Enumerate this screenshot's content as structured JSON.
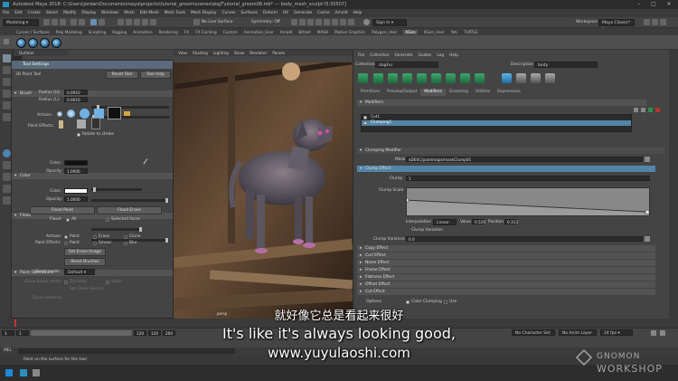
{
  "window": {
    "title": "Autodesk Maya 2018: C:\\Users\\jordan\\Documents\\maya\\projects\\tutorial_groom\\scenes\\dogT\\utorial_groom08.mb* --- body_mesh_sculpt:f3:30507]"
  },
  "menu": [
    "File",
    "Edit",
    "Create",
    "Select",
    "Modify",
    "Display",
    "Windows",
    "Mesh",
    "Edit Mesh",
    "Mesh Tools",
    "Mesh Display",
    "Curves",
    "Surfaces",
    "Deform",
    "UV",
    "Generate",
    "Cache",
    "Arnold",
    "Help"
  ],
  "statusline": {
    "mode": "Modeling",
    "no_live_surface": "No Live Surface",
    "symmetry": "Symmetry: Off",
    "sign_in": "Sign In",
    "workspace_label": "Workspace :",
    "workspace": "Maya Classic*"
  },
  "shelf_tabs": [
    "Curves / Surfaces",
    "Poly Modeling",
    "Sculpting",
    "Rigging",
    "Animation",
    "Rendering",
    "FX",
    "FX Caching",
    "Custom",
    "Animation_User",
    "Arnold",
    "Bifrost",
    "MASH",
    "Motion Graphics",
    "Polygon_User",
    "XGen",
    "XGen_User",
    "Yeti",
    "TURTLE"
  ],
  "shelf_active_tab": "XGen",
  "viewport": {
    "menu": [
      "View",
      "Shading",
      "Lighting",
      "Show",
      "Renderer",
      "Panels"
    ],
    "camera_label": "persp"
  },
  "outliner_label": "Outliner",
  "tool_settings": {
    "title": "Tool Settings",
    "tool_name": "3D Paint Tool",
    "reset_button": "Reset Tool",
    "help_button": "Tool Help",
    "brush_header": "Brush",
    "radius_u_label": "Radius (U):",
    "radius_u_value": "0.0910",
    "radius_l_label": "Radius (L):",
    "radius_l_value": "0.0010",
    "artisan_label": "Artisan:",
    "paint_effects_label": "Paint Effects:",
    "rotate_label": "Rotate to stroke",
    "color_header": "Color",
    "color_label": "Color:",
    "opacity_label": "Opacity:",
    "opacity_value": "1.0000",
    "flood_header": "Flood",
    "flood_color_label": "Color:",
    "flood_opacity_label": "Opacity:",
    "flood_opacity_value": "1.0000",
    "flood_paint_button": "Flood Paint",
    "flood_erase_button": "Flood Erase",
    "flood_label": "Flood:",
    "flood_all": "All",
    "flood_selected": "Selected faces",
    "paint_ops_header": "Paint Operations",
    "artisan_ops_label": "Artisan:",
    "op_paint": "Paint",
    "op_erase": "Erase",
    "op_clone": "Clone",
    "pe_ops_label": "Paint Effects:",
    "op_paint2": "Paint",
    "op_smear": "Smear",
    "op_blur": "Blur",
    "set_erase_button": "Set Erase Image",
    "reset_brushes_button": "Reset Brushes",
    "blend_mode_label": "Blend mode:",
    "blend_mode_value": "Default",
    "clone_brush_label": "Clone brush mode:",
    "clone_dynamic": "Dynamic",
    "clone_static": "Static",
    "set_clone_source": "Set Clone Source",
    "clone_intensity_label": "Clone intensity:",
    "file_textures_header": "File Textures"
  },
  "xgen": {
    "menu": [
      "File",
      "Collection",
      "Generate",
      "Guides",
      "Log",
      "Help"
    ],
    "collection_label": "Collection",
    "collection_value": "dogFur",
    "description_label": "Description",
    "description_value": "body",
    "tabs": [
      "Primitives",
      "Preview/Output",
      "Modifiers",
      "Grooming",
      "Utilities",
      "Expressions"
    ],
    "active_tab": "Modifiers",
    "modifiers_header": "Modifiers",
    "modifier_items": [
      "Cut1",
      "Clumping1"
    ],
    "selected_modifier": "Clumping1",
    "clumping_header": "Clumping Modifier",
    "mask_label": "Mask",
    "mask_value": "$DESC/paintmaps/maskClump01",
    "clump_effect_header": "Clump Effect",
    "clump_label": "Clump",
    "clump_value": "1",
    "clump_scale_label": "Clump Scale",
    "interpolation_label": "Interpolation",
    "interpolation_value": "Linear",
    "value_label": "Value",
    "value_value": "0.526",
    "position_label": "Position",
    "position_value": "0.312",
    "clump_variation_label": "Clump Variation",
    "clump_variance_label": "Clump Variance",
    "clump_variance_value": "0.0",
    "collapsed_sections": [
      "Copy Effect",
      "Curl Effect",
      "Noise Effect",
      "Frame Effect",
      "Flatness Effect",
      "Offset Effect",
      "Cut Effect"
    ],
    "footer_text": "Options",
    "color_clumping_label": "Color Clumping",
    "use_label": "Use"
  },
  "range": {
    "start": "1",
    "start2": "1",
    "end": "120",
    "end2": "120",
    "end3": "200",
    "character_set": "No Character Set",
    "anim_layer": "No Anim Layer",
    "fps": "24 fps"
  },
  "command_line_label": "MEL",
  "help_line": "Paint on the surface for the tool",
  "subtitle": {
    "chinese": "就好像它总是看起来很好",
    "english": "It's like it's always looking good,",
    "url": "www.yuyulaoshi.com"
  },
  "watermark": {
    "line1": "GNOMON",
    "line2": "WORKSHOP"
  },
  "colors": {
    "selection_blue": "#5285a6",
    "xgen_green": "#3fa66c",
    "maya_panel": "#444444"
  }
}
